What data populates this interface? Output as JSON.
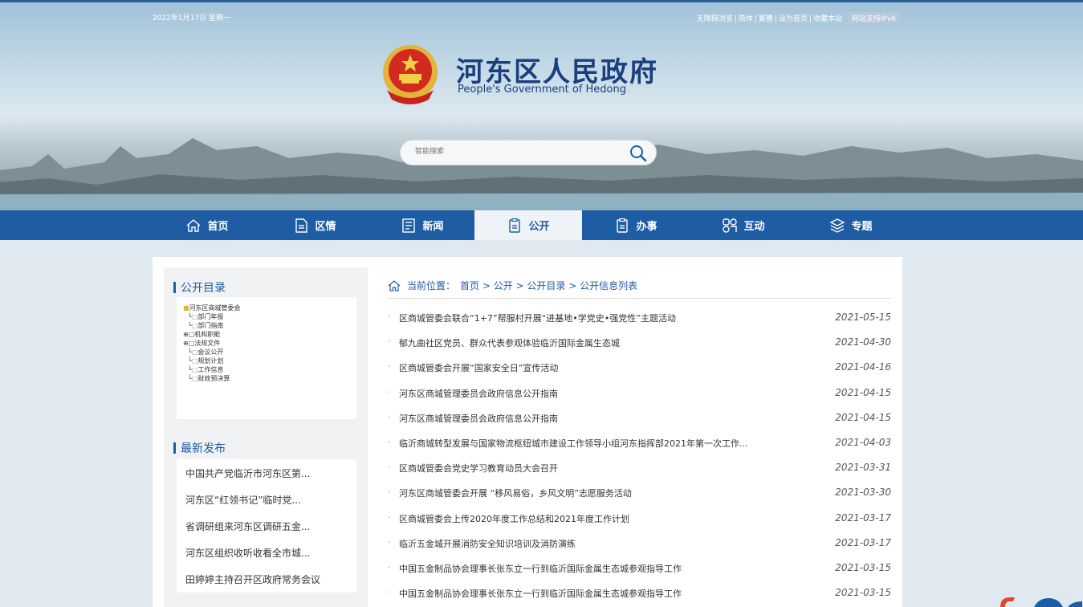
{
  "header": {
    "date": "2022年1月17日 星期一",
    "links": [
      "无障碍浏览",
      "简体",
      "繁體",
      "设为首页",
      "收藏本站"
    ],
    "ipv6": "网站支持IPv6",
    "title": "河东区人民政府",
    "subtitle": "People's Government of Hedong",
    "search_placeholder": "智能搜索"
  },
  "nav": [
    {
      "label": "首页",
      "icon": "home-icon"
    },
    {
      "label": "区情",
      "icon": "document-icon"
    },
    {
      "label": "新闻",
      "icon": "news-icon"
    },
    {
      "label": "公开",
      "icon": "public-icon",
      "active": true
    },
    {
      "label": "办事",
      "icon": "clipboard-icon"
    },
    {
      "label": "互动",
      "icon": "interact-icon"
    },
    {
      "label": "专题",
      "icon": "layers-icon"
    }
  ],
  "sidebar": {
    "catalog_title": "公开目录",
    "tree": [
      "河东区商城管委会",
      "部门年报",
      "部门指南",
      "机构职能",
      "法规文件",
      "会议公开",
      "规划计划",
      "工作信息",
      "财政预决算"
    ],
    "latest_title": "最新发布",
    "latest": [
      "中国共产党临沂市河东区第...",
      "河东区“红领书记”临时党...",
      "省调研组来河东区调研五金...",
      "河东区组织收听收看全市城...",
      "田婷婷主持召开区政府常务会议"
    ]
  },
  "main": {
    "breadcrumb_label": "当前位置：",
    "breadcrumb": "首页 > 公开 > 公开目录 > 公开信息列表",
    "items": [
      {
        "title": "区商城管委会联合“1+7”帮服村开展“进基地•学党史•强党性”主题活动",
        "date": "2021-05-15"
      },
      {
        "title": "郁九曲社区党员、群众代表参观体验临沂国际金属生态城",
        "date": "2021-04-30"
      },
      {
        "title": "区商城管委会开展“国家安全日”宣传活动",
        "date": "2021-04-16"
      },
      {
        "title": "河东区商城管理委员会政府信息公开指南",
        "date": "2021-04-15"
      },
      {
        "title": "河东区商城管理委员会政府信息公开指南",
        "date": "2021-04-15"
      },
      {
        "title": "临沂商城转型发展与国家物流枢纽城市建设工作领导小组河东指挥部2021年第一次工作...",
        "date": "2021-04-03"
      },
      {
        "title": "区商城管委会党史学习教育动员大会召开",
        "date": "2021-03-31"
      },
      {
        "title": "河东区商城管委会开展 “移风易俗，乡风文明”志愿服务活动",
        "date": "2021-03-30"
      },
      {
        "title": "区商城管委会上传2020年度工作总结和2021年度工作计划",
        "date": "2021-03-17"
      },
      {
        "title": "临沂五金城开展消防安全知识培训及消防演练",
        "date": "2021-03-17"
      },
      {
        "title": "中国五金制品协会理事长张东立一行到临沂国际金属生态城参观指导工作",
        "date": "2021-03-15"
      },
      {
        "title": "中国五金制品协会理事长张东立一行到临沂国际金属生态城参观指导工作",
        "date": "2021-03-15"
      }
    ]
  }
}
